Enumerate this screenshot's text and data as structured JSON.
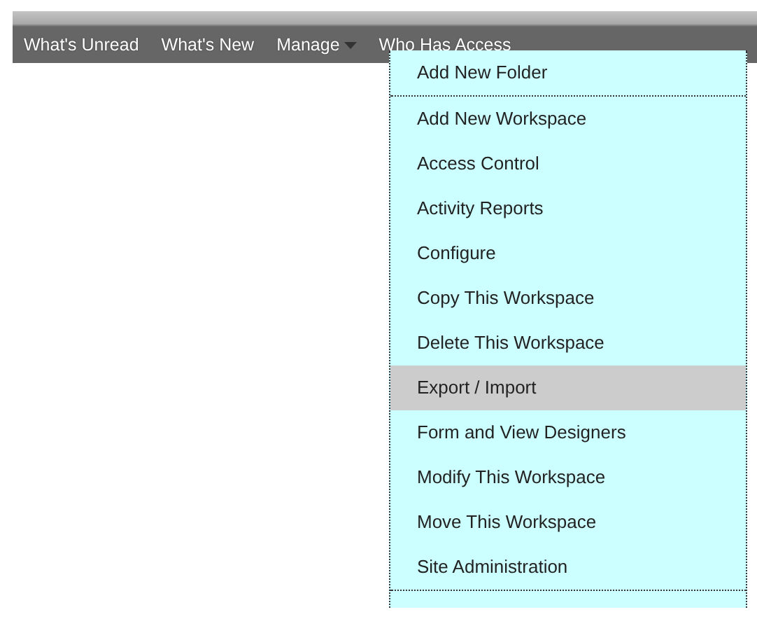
{
  "nav": [
    {
      "label": "What's Unread",
      "dropdown": false
    },
    {
      "label": "What's New",
      "dropdown": false
    },
    {
      "label": "Manage",
      "dropdown": true
    },
    {
      "label": "Who Has Access",
      "dropdown": false
    }
  ],
  "menu": {
    "items": [
      {
        "label": "Add New Folder",
        "selected": false
      },
      {
        "label": "Add New Workspace",
        "selected": false
      },
      {
        "label": "Access Control",
        "selected": false
      },
      {
        "label": "Activity Reports",
        "selected": false
      },
      {
        "label": "Configure",
        "selected": false
      },
      {
        "label": "Copy This Workspace",
        "selected": false
      },
      {
        "label": "Delete This Workspace",
        "selected": false
      },
      {
        "label": "Export / Import",
        "selected": true
      },
      {
        "label": "Form and View Designers",
        "selected": false
      },
      {
        "label": "Modify This Workspace",
        "selected": false
      },
      {
        "label": "Move This Workspace",
        "selected": false
      },
      {
        "label": "Site Administration",
        "selected": false
      }
    ]
  }
}
